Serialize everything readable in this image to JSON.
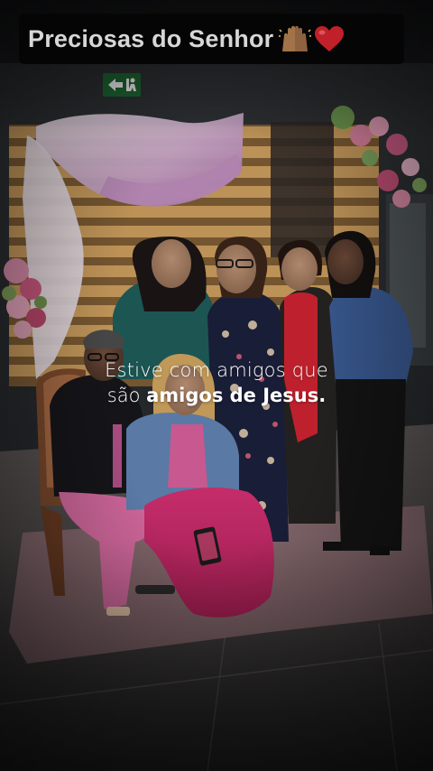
{
  "story": {
    "title_text": "Preciosas do Senhor",
    "title_icons": [
      "raised-hands-emoji",
      "red-heart-emoji"
    ],
    "caption_line1": "Estive com amigos que",
    "caption_line2_regular": "são",
    "caption_line2_bold": "amigos de Jesus."
  },
  "colors": {
    "title_background": "#050505",
    "title_text": "#d7d7d7",
    "caption_text": "#ffffff",
    "exit_sign_green": "#1f6b35",
    "heart_red": "#c0202a"
  }
}
